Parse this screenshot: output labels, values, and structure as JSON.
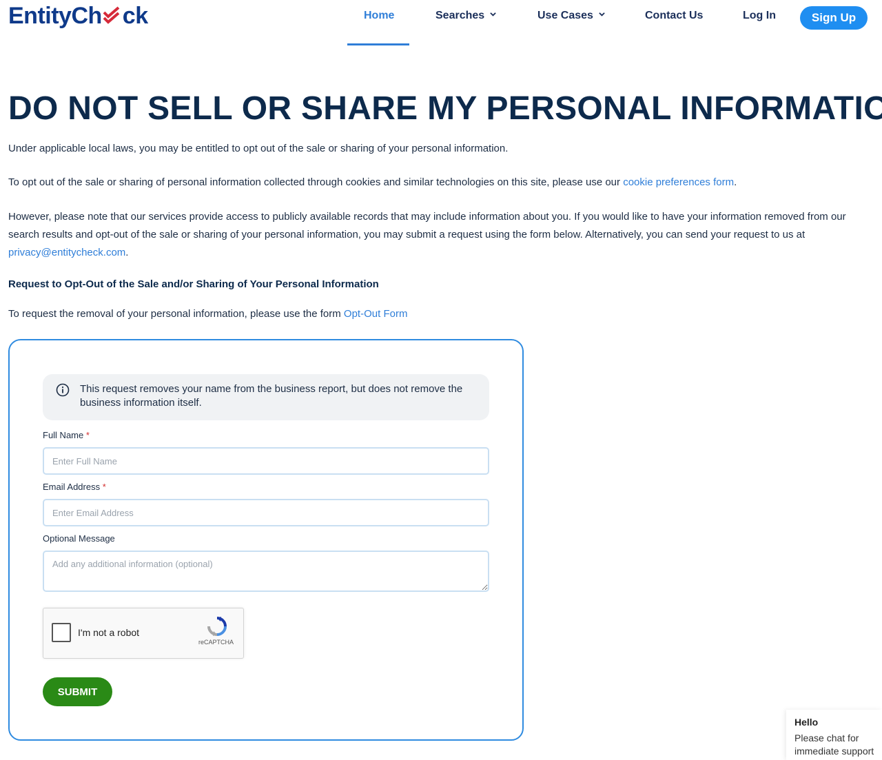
{
  "brand": {
    "logo_text_a": "EntityCh",
    "logo_text_b": "ck"
  },
  "nav": {
    "home": "Home",
    "searches": "Searches",
    "use_cases": "Use Cases",
    "contact": "Contact Us",
    "login": "Log In",
    "signup": "Sign Up"
  },
  "page": {
    "title": "DO NOT SELL OR SHARE MY PERSONAL INFORMATION",
    "intro": "Under applicable local laws, you may be entitled to opt out of the sale or sharing of your personal information.",
    "cookies_pre": "To opt out of the sale or sharing of personal information collected through cookies and similar technologies on this site, please use our ",
    "cookies_link": "cookie preferences form",
    "cookies_post": ".",
    "public_records_pre": "However, please note that our services provide access to publicly available records that may include information about you. If you would like to have your information removed from our search results and opt-out of the sale or sharing of your personal information, you may submit a request using the form below. Alternatively, you can send your request to us at ",
    "privacy_email": "privacy@entitycheck.com",
    "public_records_post": ".",
    "request_heading": "Request to Opt-Out of the Sale and/or Sharing of Your Personal Information",
    "removal_pre": "To request the removal of your personal information, please use the form ",
    "removal_link": "Opt-Out Form"
  },
  "form": {
    "notice": "This request removes your name from the business report, but does not remove the business information itself.",
    "full_name_label": "Full Name",
    "full_name_placeholder": "Enter Full Name",
    "email_label": "Email Address",
    "email_placeholder": "Enter Email Address",
    "message_label": "Optional Message",
    "message_placeholder": "Add any additional information (optional)",
    "required_mark": "*",
    "captcha_label": "I'm not a robot",
    "captcha_brand": "reCAPTCHA",
    "submit": "SUBMIT"
  },
  "chat": {
    "title": "Hello",
    "line1": "Please chat for",
    "line2": "immediate support"
  },
  "colors": {
    "brand_blue": "#0f3a8a",
    "accent_red": "#d62a3a",
    "link_blue": "#2f7ed8",
    "signup_blue": "#1f8ef1",
    "submit_green": "#2a8a16"
  }
}
